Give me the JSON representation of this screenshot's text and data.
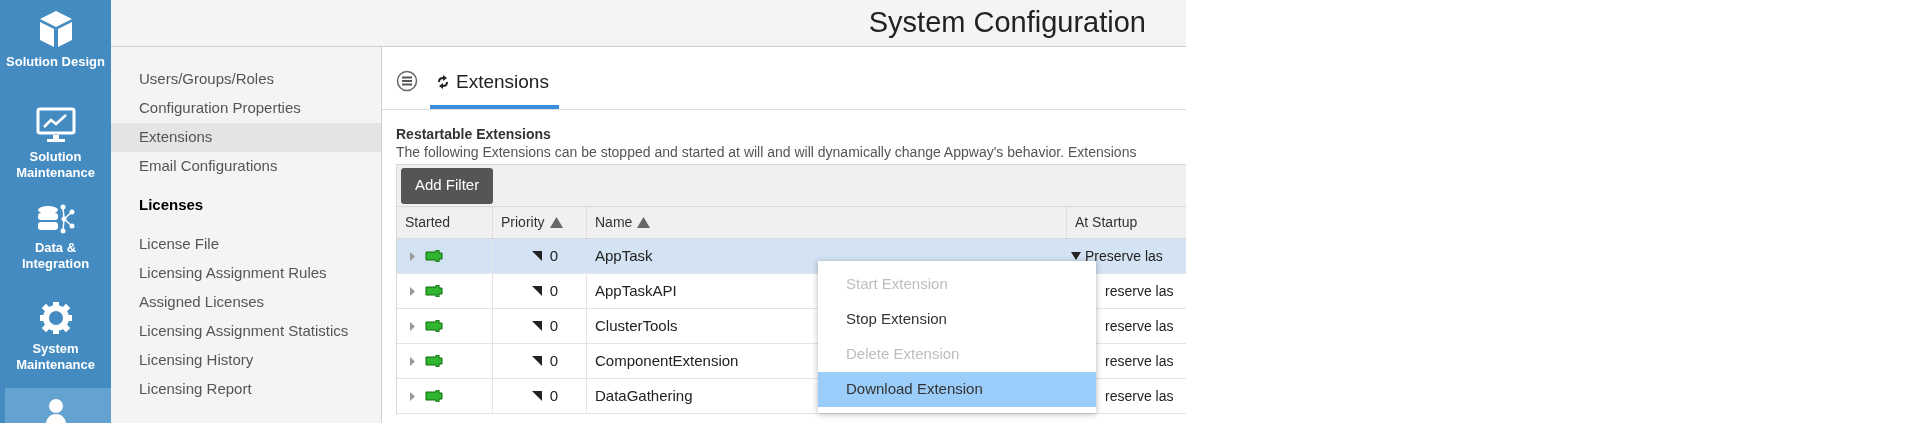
{
  "nav": [
    {
      "label": "Solution Design",
      "selected": false
    },
    {
      "label": "Solution Maintenance",
      "selected": false
    },
    {
      "label": "Data & Integration",
      "selected": false
    },
    {
      "label": "System Maintenance",
      "selected": false
    },
    {
      "selected": true
    }
  ],
  "header": {
    "title": "System Configuration"
  },
  "submenu": [
    {
      "kind": "item",
      "label": "Users/Groups/Roles",
      "selected": false
    },
    {
      "kind": "item",
      "label": "Configuration Properties",
      "selected": false
    },
    {
      "kind": "item",
      "label": "Extensions",
      "selected": true
    },
    {
      "kind": "item",
      "label": "Email Configurations",
      "selected": false
    },
    {
      "kind": "heading",
      "label": "Licenses"
    },
    {
      "kind": "item",
      "label": "License File",
      "selected": false
    },
    {
      "kind": "item",
      "label": "Licensing Assignment Rules",
      "selected": false
    },
    {
      "kind": "item",
      "label": "Assigned Licenses",
      "selected": false
    },
    {
      "kind": "item",
      "label": "Licensing Assignment Statistics",
      "selected": false
    },
    {
      "kind": "item",
      "label": "Licensing History",
      "selected": false
    },
    {
      "kind": "item",
      "label": "Licensing Report",
      "selected": false
    }
  ],
  "tabs": [
    {
      "label": "Extensions",
      "selected": true
    }
  ],
  "section": {
    "title": "Restartable Extensions",
    "description": "The following Extensions can be stopped and started at will and will dynamically change Appway's behavior. Extensions"
  },
  "filter_button": "Add Filter",
  "table": {
    "columns": [
      {
        "label": "Started",
        "sorted": false
      },
      {
        "label": "Priority",
        "sorted": true
      },
      {
        "label": "Name",
        "sorted": true
      },
      {
        "label": "At Startup",
        "sorted": false
      }
    ],
    "rows": [
      {
        "priority": "0",
        "name": "AppTask",
        "at_startup": "Preserve las",
        "selected": true
      },
      {
        "priority": "0",
        "name": "AppTaskAPI",
        "at_startup": "reserve las",
        "selected": false
      },
      {
        "priority": "0",
        "name": "ClusterTools",
        "at_startup": "reserve las",
        "selected": false
      },
      {
        "priority": "0",
        "name": "ComponentExtension",
        "at_startup": "reserve las",
        "selected": false
      },
      {
        "priority": "0",
        "name": "DataGathering",
        "at_startup": "reserve las",
        "selected": false
      }
    ]
  },
  "context_menu": [
    {
      "label": "Start Extension",
      "disabled": true,
      "selected": false
    },
    {
      "label": "Stop Extension",
      "disabled": false,
      "selected": false
    },
    {
      "label": "Delete Extension",
      "disabled": true,
      "selected": false
    },
    {
      "label": "Download Extension",
      "disabled": false,
      "selected": true
    }
  ]
}
